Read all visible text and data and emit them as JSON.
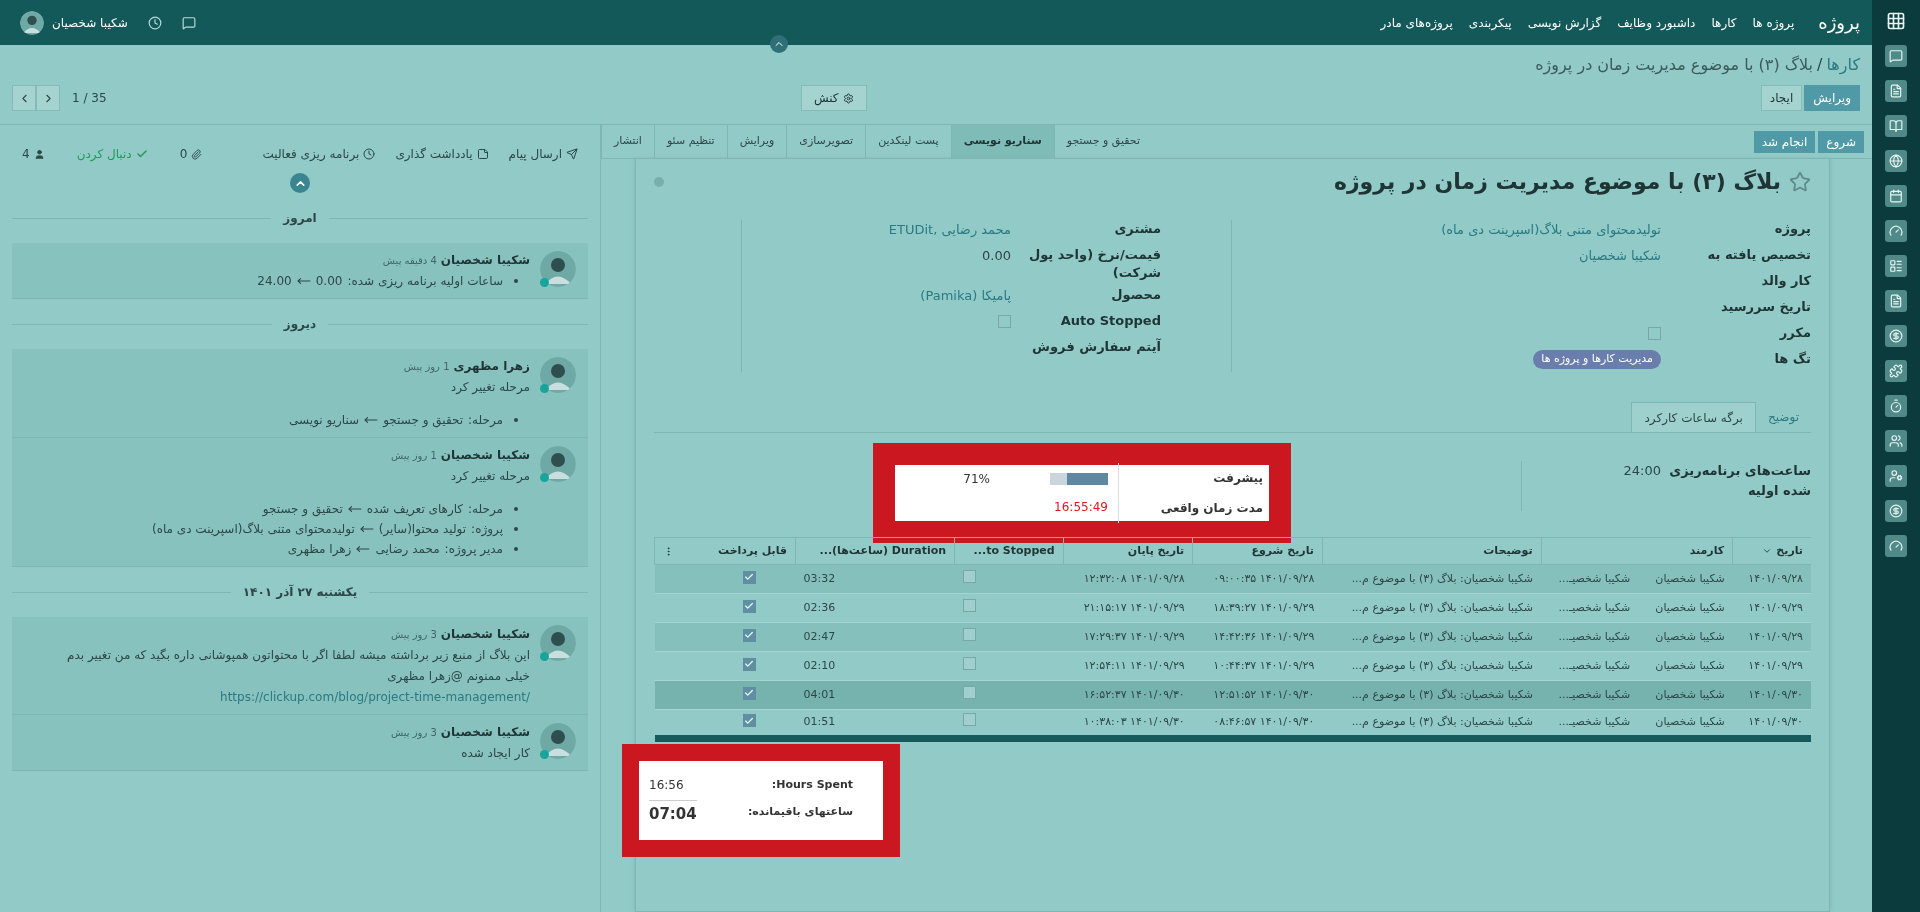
{
  "top_bar": {
    "app_name": "پروژه",
    "menu": [
      "پروژه ها",
      "کارها",
      "داشبورد وظایف",
      "گزارش نویسی",
      "پیکربندی",
      "پروژه‌های مادر"
    ],
    "user": "شکیبا شخصیان"
  },
  "control_panel": {
    "breadcrumb": [
      {
        "label": "کارها",
        "kind": "link"
      },
      {
        "label": "بلاگ (۳) با موضوع مدیریت زمان در پروژه",
        "kind": "current"
      }
    ],
    "separator": "/",
    "buttons": [
      {
        "label": "ویرایش",
        "primary": true
      },
      {
        "label": "ایجاد",
        "primary": false
      }
    ],
    "action_menu": "کنش",
    "pager": "1 / 35"
  },
  "status_bar": {
    "buttons": [
      "شروع",
      "انجام شد"
    ],
    "stages": [
      {
        "label": "تحقیق و جستجو",
        "selected": false
      },
      {
        "label": "سناریو نویسی",
        "selected": true
      },
      {
        "label": "پست لینکدین",
        "selected": false
      },
      {
        "label": "تصویرسازی",
        "selected": false
      },
      {
        "label": "ویرایش",
        "selected": false
      },
      {
        "label": "تنظیم سئو",
        "selected": false
      },
      {
        "label": "انتشار",
        "selected": false
      }
    ]
  },
  "form": {
    "title": "بلاگ (۳) با موضوع مدیریت زمان در پروژه",
    "starred": false,
    "fields_right": [
      {
        "label": "پروژه",
        "kind": "link",
        "value": "تولیدمحتوای متنی بلاگ(اسپرینت دی ماه)"
      },
      {
        "label": "تخصیص یافته به",
        "kind": "link",
        "value": "شکیبا شخصیان"
      },
      {
        "label": "کار والد",
        "kind": "empty"
      },
      {
        "label": "تاریخ سررسید",
        "kind": "empty"
      },
      {
        "label": "مکرر",
        "kind": "checkbox",
        "checked": false
      },
      {
        "label": "تگ ها",
        "kind": "tag",
        "value": "مدیریت کارها و پروژه ها"
      }
    ],
    "fields_left": [
      {
        "label": "مشتری",
        "kind": "link",
        "value": "ETUDit, محمد رضایی"
      },
      {
        "label": "قیمت/نرخ (واحد پول شرکت)",
        "kind": "text",
        "value": "0.00"
      },
      {
        "label": "محصول",
        "kind": "link",
        "value": "پامیکا (Pamika)"
      },
      {
        "label": "Auto Stopped",
        "kind": "checkbox",
        "checked": false
      },
      {
        "label": "آیتم سفارش فروش",
        "kind": "empty"
      }
    ],
    "tabs": [
      {
        "label": "توضیح",
        "selected": false
      },
      {
        "label": "برگه ساعات کارکرد",
        "selected": true
      }
    ],
    "planned_hours": {
      "label": "ساعت‌های برنامه‌ریزی شده اولیه",
      "value": "24:00"
    },
    "progress": {
      "label": "پیشرفت",
      "level": 0.71,
      "reading": "71%"
    },
    "effective": {
      "label": "مدت زمان واقعی",
      "value": "16:55:49"
    },
    "timesheet": {
      "columns": [
        "تاریخ",
        "کارمند",
        "توضیحات",
        "تاریخ شروع",
        "تاریخ پایان",
        "to Stopped...",
        "Duration (ساعت‌ها)...",
        "قابل پرداخت"
      ],
      "rows": [
        {
          "date": "۱۴۰۱/۰۹/۲۸",
          "employee": "شکیبا شخصیان",
          "employee_2": "شکیبا شخصیـ...",
          "description": "شکیبا شخصیان: بلاگ (۳) با موضوع م...",
          "start": "۱۴۰۱/۰۹/۲۸ ۰۹:۰۰:۳۵",
          "end": "۱۴۰۱/۰۹/۲۸ ۱۲:۳۲:۰۸",
          "stopped": false,
          "duration": "03:32",
          "billable": true,
          "highlighted": false
        },
        {
          "date": "۱۴۰۱/۰۹/۲۹",
          "employee": "شکیبا شخصیان",
          "employee_2": "شکیبا شخصیـ...",
          "description": "شکیبا شخصیان: بلاگ (۳) با موضوع م...",
          "start": "۱۴۰۱/۰۹/۲۹ ۱۸:۳۹:۲۷",
          "end": "۱۴۰۱/۰۹/۲۹ ۲۱:۱۵:۱۷",
          "stopped": false,
          "duration": "02:36",
          "billable": true,
          "highlighted": false
        },
        {
          "date": "۱۴۰۱/۰۹/۲۹",
          "employee": "شکیبا شخصیان",
          "employee_2": "شکیبا شخصیـ...",
          "description": "شکیبا شخصیان: بلاگ (۳) با موضوع م...",
          "start": "۱۴۰۱/۰۹/۲۹ ۱۴:۴۲:۳۶",
          "end": "۱۴۰۱/۰۹/۲۹ ۱۷:۲۹:۳۷",
          "stopped": false,
          "duration": "02:47",
          "billable": true,
          "highlighted": false
        },
        {
          "date": "۱۴۰۱/۰۹/۲۹",
          "employee": "شکیبا شخصیان",
          "employee_2": "شکیبا شخصیـ...",
          "description": "شکیبا شخصیان: بلاگ (۳) با موضوع م...",
          "start": "۱۴۰۱/۰۹/۲۹ ۱۰:۴۴:۳۷",
          "end": "۱۴۰۱/۰۹/۲۹ ۱۲:۵۴:۱۱",
          "stopped": false,
          "duration": "02:10",
          "billable": true,
          "highlighted": false
        },
        {
          "date": "۱۴۰۱/۰۹/۳۰",
          "employee": "شکیبا شخصیان",
          "employee_2": "شکیبا شخصیـ...",
          "description": "شکیبا شخصیان: بلاگ (۳) با موضوع م...",
          "start": "۱۴۰۱/۰۹/۳۰ ۱۲:۵۱:۵۲",
          "end": "۱۴۰۱/۰۹/۳۰ ۱۶:۵۲:۳۷",
          "stopped": false,
          "duration": "04:01",
          "billable": true,
          "highlighted": true
        },
        {
          "date": "۱۴۰۱/۰۹/۳۰",
          "employee": "شکیبا شخصیان",
          "employee_2": "شکیبا شخصیـ...",
          "description": "شکیبا شخصیان: بلاگ (۳) با موضوع م...",
          "start": "۱۴۰۱/۰۹/۳۰ ۰۸:۴۶:۵۷",
          "end": "۱۴۰۱/۰۹/۳۰ ۱۰:۳۸:۰۳",
          "stopped": false,
          "duration": "01:51",
          "billable": true,
          "highlighted": false
        }
      ]
    },
    "totals": [
      {
        "label": "Hours Spent:",
        "value": "16:56",
        "kind": "plain"
      },
      {
        "label": "ساعتهای باقیمانده:",
        "value": "07:04",
        "kind": "total"
      }
    ]
  },
  "chatter": {
    "actions": [
      {
        "label": "ارسال پیام",
        "kind": "send"
      },
      {
        "label": "یادداشت گذاری",
        "kind": "note"
      },
      {
        "label": "برنامه ریزی فعالیت",
        "kind": "activity"
      }
    ],
    "attachments": "0",
    "follow": "دنبال کردن",
    "following": true,
    "followers": "4",
    "groups": [
      {
        "date": "امروز",
        "messages": [
          {
            "author": "شکیبا شخصیان",
            "time": "4 دقیقه پیش",
            "online": true,
            "tracking": [
              {
                "field": "ساعات اولیه برنامه ریزی شده:",
                "old": "0.00",
                "new": "24.00"
              }
            ]
          }
        ]
      },
      {
        "date": "دیروز",
        "messages": [
          {
            "author": "زهرا مظهری",
            "time": "1 روز پیش",
            "online": true,
            "body": [
              "مرحله تغییر کرد"
            ],
            "tracking": [
              {
                "field": "مرحله:",
                "old": "تحقیق و جستجو",
                "new": "سناریو نویسی"
              }
            ]
          },
          {
            "author": "شکیبا شخصیان",
            "time": "1 روز پیش",
            "online": true,
            "body": [
              "مرحله تغییر کرد"
            ],
            "tracking": [
              {
                "field": "مرحله:",
                "old": "کارهای تعریف شده",
                "new": "تحقیق و جستجو"
              },
              {
                "field": "پروژه:",
                "old": "تولید محتوا(سایر)",
                "new": "تولیدمحتوای متنی بلاگ(اسپرینت دی ماه)"
              },
              {
                "field": "مدیر پروژه:",
                "old": "محمد رضایی",
                "new": "زهرا مظهری"
              }
            ]
          }
        ]
      },
      {
        "date": "یکشنبه ۲۷ آذر ۱۴۰۱",
        "messages": [
          {
            "author": "شکیبا شخصیان",
            "time": "3 روز پیش",
            "online": true,
            "body": [
              "این بلاگ از منبع زیر برداشته میشه لطفا اگر با محتواتون همپوشانی داره بگید که من تغییر بدم",
              "خیلی ممنونم @زهرا مظهری"
            ],
            "link": "https://clickup.com/blog/project-time-management/"
          },
          {
            "author": "شکیبا شخصیان",
            "time": "3 روز پیش",
            "online": true,
            "body": [
              "کار ایجاد شده"
            ]
          }
        ]
      }
    ]
  }
}
